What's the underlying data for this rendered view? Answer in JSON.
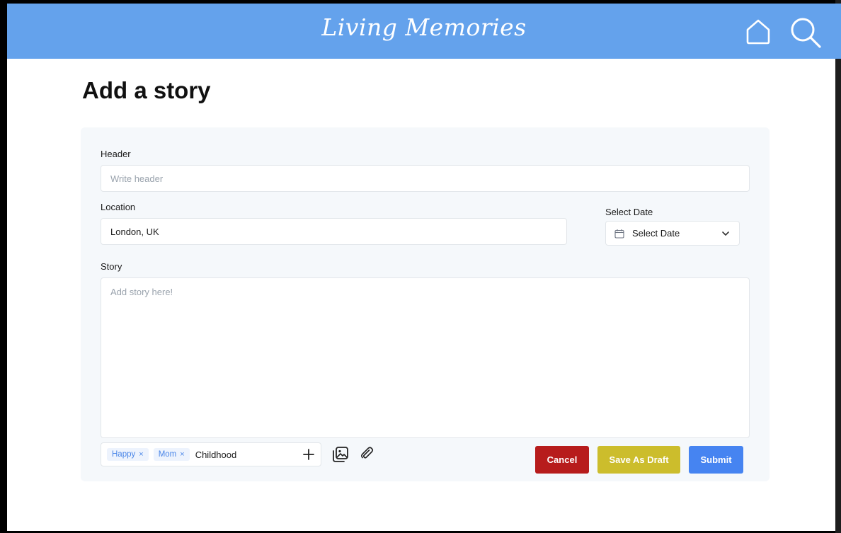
{
  "app": {
    "logo": "Living Memories"
  },
  "page": {
    "title": "Add a story"
  },
  "form": {
    "header_label": "Header",
    "header_placeholder": "Write header",
    "location_label": "Location",
    "location_value": "London, UK",
    "date_label": "Select Date",
    "date_value": "Select Date",
    "story_label": "Story",
    "story_placeholder": "Add story here!"
  },
  "tags": {
    "items": [
      {
        "label": "Happy",
        "remove": "×"
      },
      {
        "label": "Mom",
        "remove": "×"
      }
    ],
    "input_value": "Childhood"
  },
  "actions": {
    "cancel_label": "Cancel",
    "draft_label": "Save As Draft",
    "submit_label": "Submit"
  },
  "colors": {
    "topbar": "#64a2ec",
    "cancel": "#b71c1c",
    "draft": "#ccbd2c",
    "submit": "#4684f1",
    "tag_text": "#4a86e8"
  },
  "icons": {
    "home": "home-icon",
    "search": "search-icon",
    "calendar": "calendar-icon",
    "chevron": "chevron-down-icon",
    "add_tag": "plus-icon",
    "gallery": "gallery-icon",
    "attach": "paperclip-icon"
  }
}
